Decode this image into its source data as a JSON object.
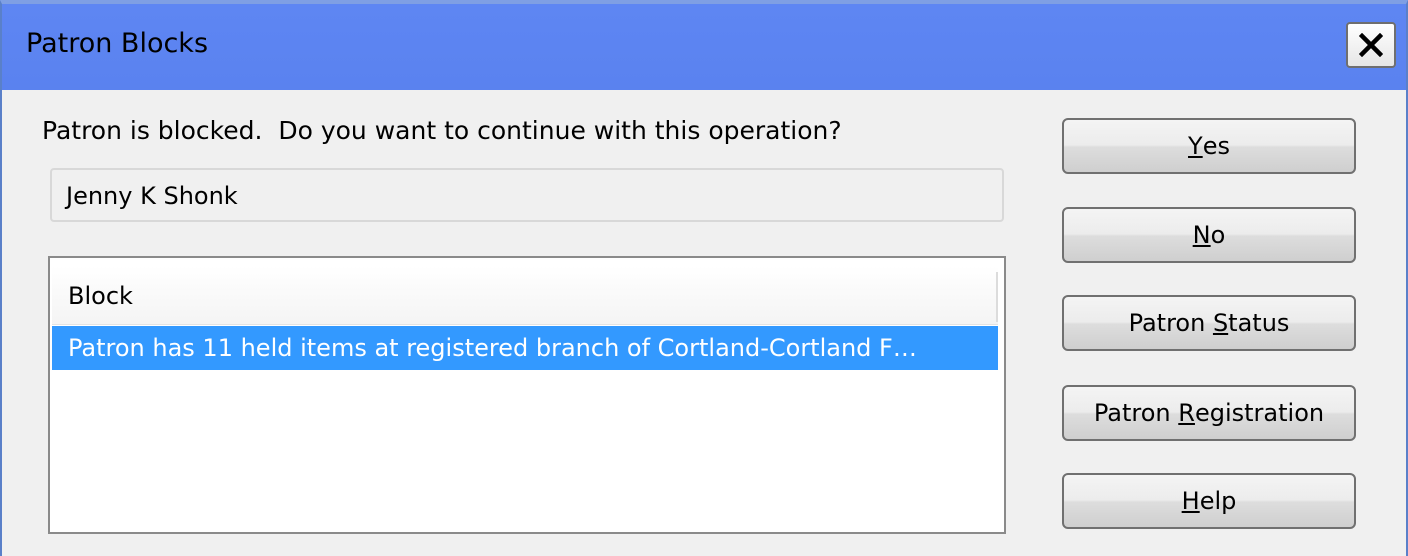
{
  "window": {
    "title": "Patron Blocks"
  },
  "dialog": {
    "prompt": "Patron is blocked.  Do you want to continue with this operation?",
    "patron_name": "Jenny K Shonk"
  },
  "blocks_list": {
    "column_header": "Block",
    "rows": [
      {
        "text": "Patron has 11 held items at registered branch of Cortland-Cortland F…",
        "selected": true
      }
    ]
  },
  "buttons": {
    "yes": {
      "pre": "",
      "key": "Y",
      "post": "es"
    },
    "no": {
      "pre": "",
      "key": "N",
      "post": "o"
    },
    "patron_status": {
      "pre": "Patron ",
      "key": "S",
      "post": "tatus"
    },
    "patron_registration": {
      "pre": "Patron ",
      "key": "R",
      "post": "egistration"
    },
    "help": {
      "pre": "",
      "key": "H",
      "post": "elp"
    }
  },
  "icons": {
    "close": "close-icon"
  },
  "colors": {
    "titlebar": "#5a82ef",
    "selection": "#3399ff",
    "dialog_bg": "#f0f0f0"
  }
}
